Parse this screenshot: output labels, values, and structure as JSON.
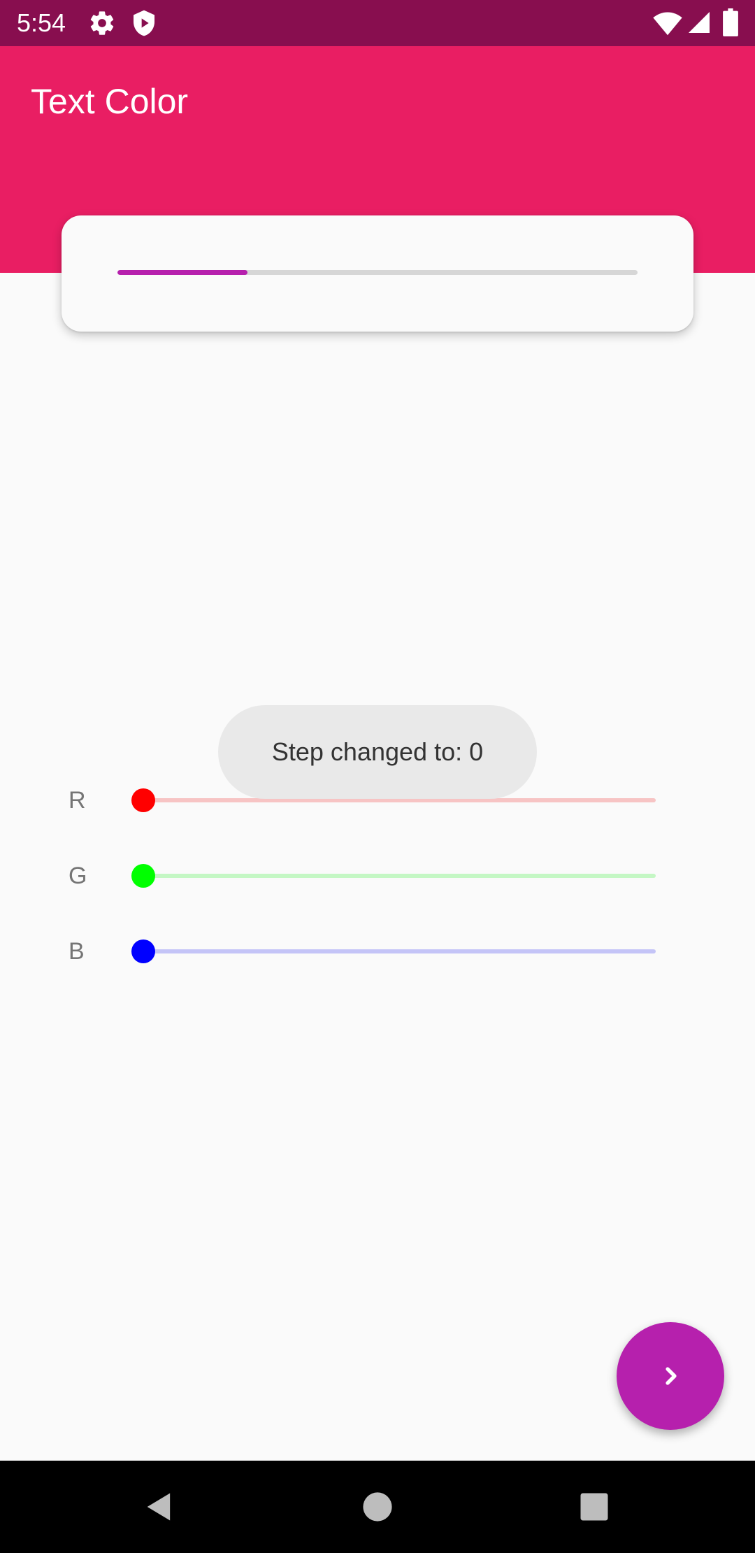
{
  "status_bar": {
    "time": "5:54",
    "icons": [
      "gear-icon",
      "shield-icon",
      "wifi-icon",
      "signal-icon",
      "battery-icon"
    ],
    "background": "#880e4f"
  },
  "app_bar": {
    "title": "Text Color",
    "background": "#e91e63"
  },
  "progress": {
    "value": 0.25,
    "fill_color": "#b620ad",
    "track_color": "#d6d6d6"
  },
  "sliders": [
    {
      "label": "R",
      "value": 0,
      "thumb_color": "#ff0000",
      "track_color": "#f7c4c4"
    },
    {
      "label": "G",
      "value": 0,
      "thumb_color": "#00ff00",
      "track_color": "#c4f7c4"
    },
    {
      "label": "B",
      "value": 0,
      "thumb_color": "#0000ff",
      "track_color": "#c4c4f7"
    }
  ],
  "toast": {
    "text": "Step changed to: 0"
  },
  "fab": {
    "icon": "chevron-right-icon",
    "color": "#b620ad"
  },
  "nav_bar": {
    "buttons": [
      "back-icon",
      "home-icon",
      "recents-icon"
    ]
  }
}
